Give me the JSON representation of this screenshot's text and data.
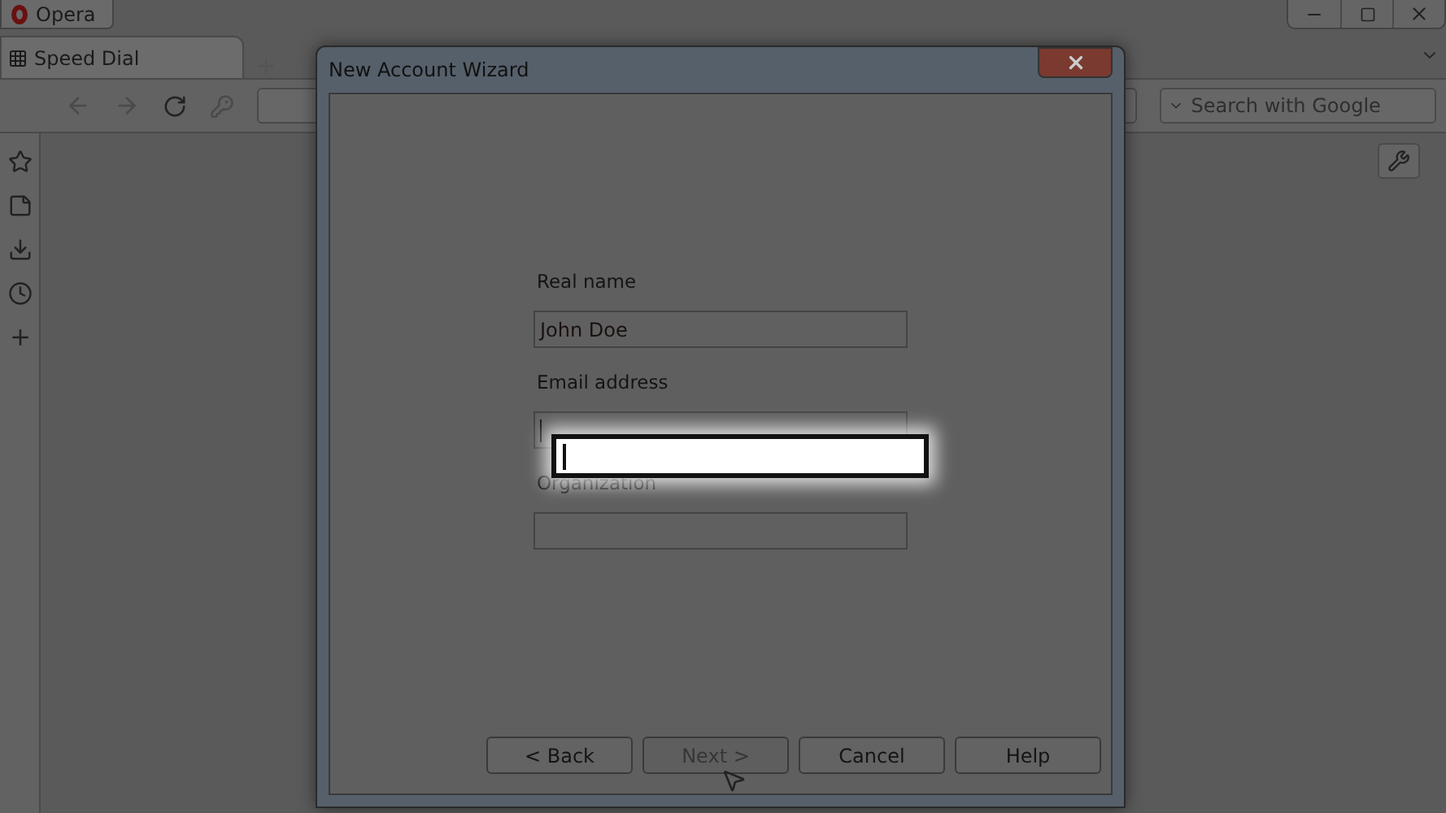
{
  "browser": {
    "menu_button": "Opera",
    "tabs": [
      {
        "label": "Speed Dial",
        "selected": true
      }
    ],
    "search": {
      "placeholder": "Search with Google"
    }
  },
  "dialog": {
    "title": "New Account Wizard",
    "fields": [
      {
        "label": "Real name",
        "value": "John Doe",
        "focused": false
      },
      {
        "label": "Email address",
        "focused": true
      },
      {
        "label": "Organization",
        "focused": false
      }
    ],
    "buttons": [
      {
        "label": "< Back",
        "disabled": false
      },
      {
        "label": "Next >",
        "disabled": true
      },
      {
        "label": "Cancel",
        "disabled": false
      },
      {
        "label": "Help",
        "disabled": false
      }
    ]
  }
}
